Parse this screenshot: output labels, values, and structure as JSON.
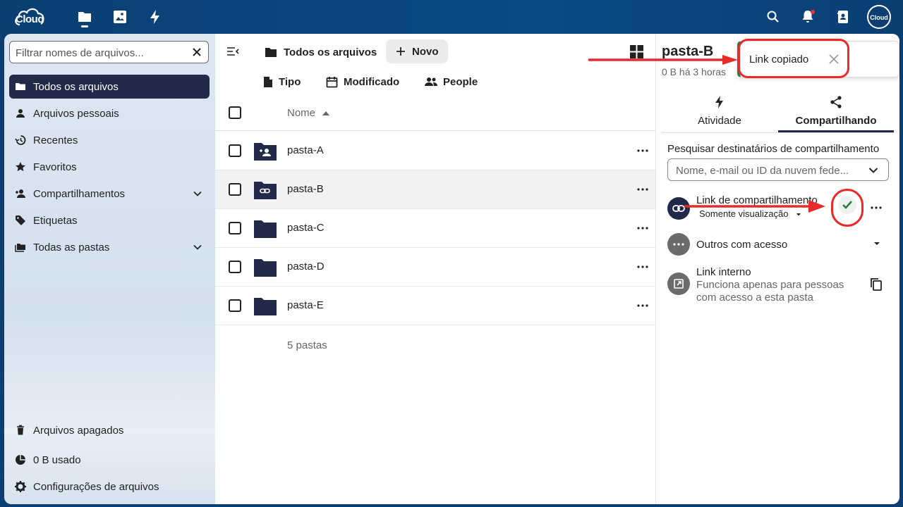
{
  "topbar": {
    "logo_text": "Cloud",
    "apps": [
      "files-icon",
      "photos-icon",
      "activity-icon"
    ],
    "right_icons": [
      "search-icon",
      "notifications-icon",
      "contacts-icon"
    ],
    "avatar_text": "Cloud",
    "colors": {
      "header": "#0b3f74",
      "accent": "#222a4a",
      "highlight": "#e82a2a",
      "success": "#2d7b41"
    }
  },
  "sidebar": {
    "filter_placeholder": "Filtrar nomes de arquivos...",
    "items": [
      {
        "label": "Todos os arquivos",
        "icon": "folder-icon",
        "active": true
      },
      {
        "label": "Arquivos pessoais",
        "icon": "user-icon"
      },
      {
        "label": "Recentes",
        "icon": "history-icon"
      },
      {
        "label": "Favoritos",
        "icon": "star-icon"
      },
      {
        "label": "Compartilhamentos",
        "icon": "share-user-icon",
        "expandable": true
      },
      {
        "label": "Etiquetas",
        "icon": "tag-icon"
      },
      {
        "label": "Todas as pastas",
        "icon": "folders-icon",
        "expandable": true
      }
    ],
    "footer": [
      {
        "label": "Arquivos apagados",
        "icon": "trash-icon"
      },
      {
        "label": "0 B usado",
        "icon": "pie-chart-icon"
      },
      {
        "label": "Configurações de arquivos",
        "icon": "settings-icon"
      }
    ]
  },
  "main": {
    "breadcrumb": "Todos os arquivos",
    "new_label": "Novo",
    "filters": [
      {
        "label": "Tipo",
        "icon": "file-icon"
      },
      {
        "label": "Modificado",
        "icon": "calendar-icon"
      },
      {
        "label": "People",
        "icon": "people-icon"
      }
    ],
    "column_name": "Nome",
    "rows": [
      {
        "name": "pasta-A",
        "type": "shared-folder",
        "selected": false
      },
      {
        "name": "pasta-B",
        "type": "link-folder",
        "selected": true
      },
      {
        "name": "pasta-C",
        "type": "folder",
        "selected": false
      },
      {
        "name": "pasta-D",
        "type": "folder",
        "selected": false
      },
      {
        "name": "pasta-E",
        "type": "folder",
        "selected": false
      }
    ],
    "summary": "5 pastas"
  },
  "panel": {
    "title": "pasta-B",
    "subtitle": "0 B há 3 horas",
    "toast": "Link copiado",
    "tabs": [
      {
        "label": "Atividade",
        "icon": "activity-icon"
      },
      {
        "label": "Compartilhando",
        "icon": "share-icon",
        "active": true
      }
    ],
    "search_label": "Pesquisar destinatários de compartilhamento",
    "search_placeholder": "Nome, e-mail ou ID da nuvem fede...",
    "share_link": {
      "title": "Link de compartilhamento",
      "permission": "Somente visualização"
    },
    "others": {
      "title": "Outros com acesso"
    },
    "internal": {
      "title": "Link interno",
      "desc": "Funciona apenas para pessoas com acesso a esta pasta"
    }
  }
}
